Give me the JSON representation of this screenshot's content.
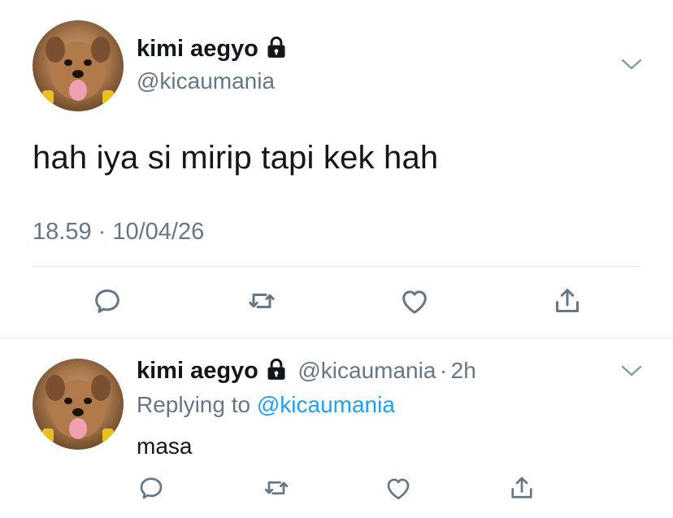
{
  "main_tweet": {
    "display_name": "kimi aegyo",
    "username": "@kicaumania",
    "text": "hah iya si mirip tapi kek hah",
    "timestamp": "18.59 · 10/04/26",
    "avatar_icon": "dog-avatar",
    "lock_icon": "lock-icon"
  },
  "reply_tweet": {
    "display_name": "kimi aegyo",
    "username": "@kicaumania",
    "separator": "·",
    "age": "2h",
    "replying_prefix": "Replying to",
    "replying_to": "@kicaumania",
    "text": "masa"
  },
  "actions": [
    "reply-icon",
    "retweet-icon",
    "like-icon",
    "share-icon"
  ],
  "colors": {
    "primary_text": "#14171a",
    "secondary_text": "#657786",
    "link": "#1da1f2",
    "divider": "#e1e8ed"
  }
}
